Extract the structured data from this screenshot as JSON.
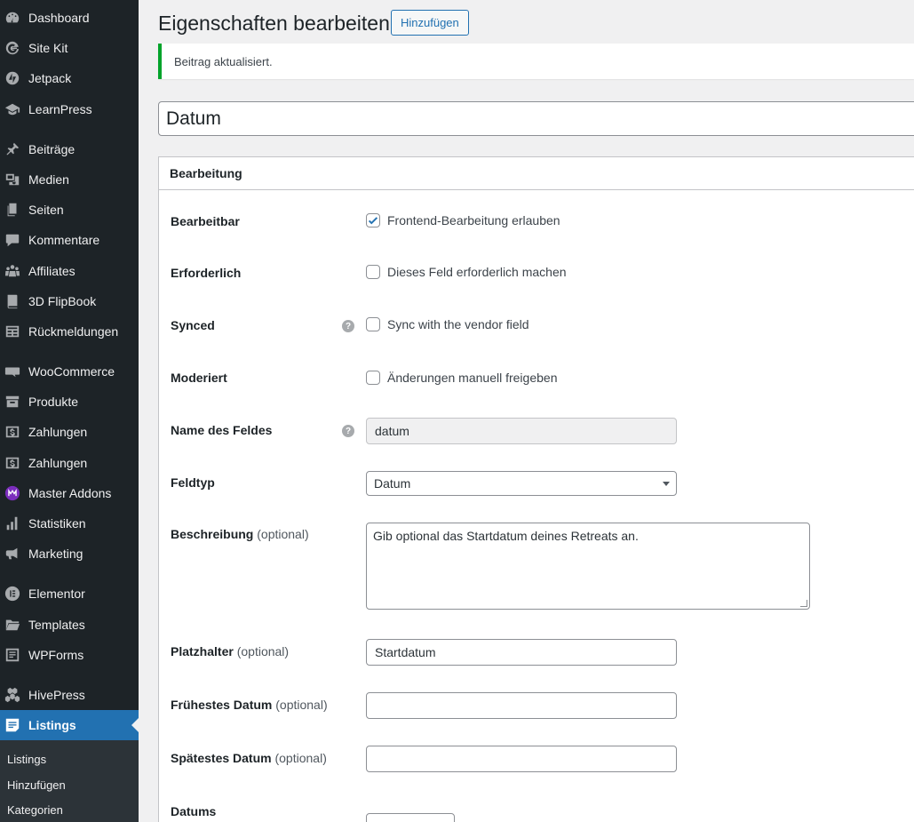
{
  "sidebar": {
    "items": [
      {
        "label": "Dashboard",
        "icon": "dashboard-icon"
      },
      {
        "label": "Site Kit",
        "icon": "google-g-icon"
      },
      {
        "label": "Jetpack",
        "icon": "jetpack-icon"
      },
      {
        "label": "LearnPress",
        "icon": "graduation-cap-icon"
      },
      {
        "label": "Beiträge",
        "icon": "pin-icon"
      },
      {
        "label": "Medien",
        "icon": "media-icon"
      },
      {
        "label": "Seiten",
        "icon": "pages-icon"
      },
      {
        "label": "Kommentare",
        "icon": "comment-icon"
      },
      {
        "label": "Affiliates",
        "icon": "groups-icon"
      },
      {
        "label": "3D FlipBook",
        "icon": "book-icon"
      },
      {
        "label": "Rückmeldungen",
        "icon": "feedback-icon"
      },
      {
        "label": "WooCommerce",
        "icon": "woocommerce-icon"
      },
      {
        "label": "Produkte",
        "icon": "archive-icon"
      },
      {
        "label": "Zahlungen",
        "icon": "dollar-icon"
      },
      {
        "label": "Zahlungen",
        "icon": "dollar-icon"
      },
      {
        "label": "Master Addons",
        "icon": "master-addons-icon"
      },
      {
        "label": "Statistiken",
        "icon": "bar-chart-icon"
      },
      {
        "label": "Marketing",
        "icon": "megaphone-icon"
      },
      {
        "label": "Elementor",
        "icon": "elementor-icon"
      },
      {
        "label": "Templates",
        "icon": "folder-icon"
      },
      {
        "label": "WPForms",
        "icon": "forms-icon"
      },
      {
        "label": "HivePress",
        "icon": "hive-icon"
      },
      {
        "label": "Listings",
        "icon": "listings-icon"
      }
    ],
    "submenu": [
      "Listings",
      "Hinzufügen",
      "Kategorien"
    ]
  },
  "header": {
    "title": "Eigenschaften bearbeiten",
    "add_button": "Hinzufügen"
  },
  "notice": "Beitrag aktualisiert.",
  "post_title": "Datum",
  "box": {
    "title": "Bearbeitung",
    "rows": {
      "editable": {
        "label": "Bearbeitbar",
        "checkbox": "Frontend-Bearbeitung erlauben",
        "checked": true
      },
      "required": {
        "label": "Erforderlich",
        "checkbox": "Dieses Feld erforderlich machen",
        "checked": false
      },
      "synced": {
        "label": "Synced",
        "checkbox": "Sync with the vendor field",
        "checked": false
      },
      "moderated": {
        "label": "Moderiert",
        "checkbox": "Änderungen manuell freigeben",
        "checked": false
      },
      "field_name": {
        "label": "Name des Feldes",
        "value": "datum"
      },
      "field_type": {
        "label": "Feldtyp",
        "value": "Datum"
      },
      "description": {
        "label": "Beschreibung",
        "optional": "(optional)",
        "value": "Gib optional das Startdatum deines Retreats an."
      },
      "placeholder": {
        "label": "Platzhalter",
        "optional": "(optional)",
        "value": "Startdatum"
      },
      "min_date": {
        "label": "Frühestes Datum",
        "optional": "(optional)",
        "value": ""
      },
      "max_date": {
        "label": "Spätestes Datum",
        "optional": "(optional)",
        "value": ""
      },
      "date_format": {
        "label": "Datums"
      }
    }
  },
  "help_glyph": "?"
}
